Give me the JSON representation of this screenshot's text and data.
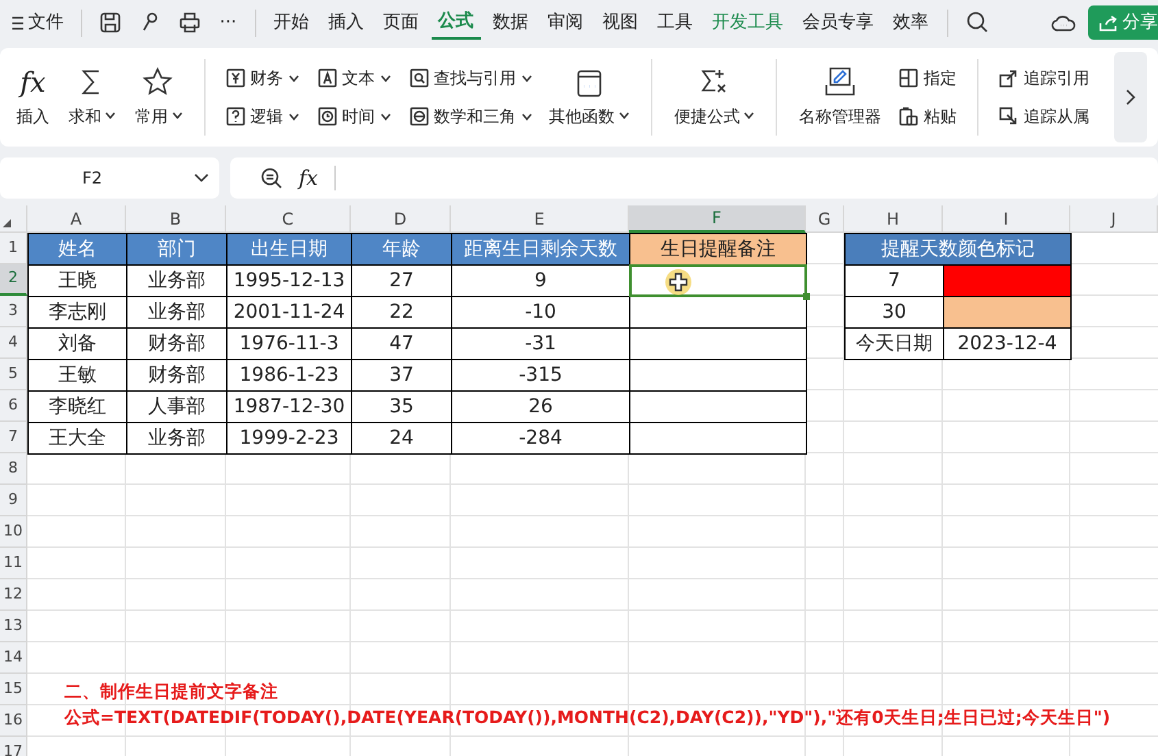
{
  "menu_bar": {
    "file_label": "文件",
    "more_label": "···",
    "tabs": [
      {
        "label": "开始",
        "selected": false,
        "accent": false
      },
      {
        "label": "插入",
        "selected": false,
        "accent": false
      },
      {
        "label": "页面",
        "selected": false,
        "accent": false
      },
      {
        "label": "公式",
        "selected": true,
        "accent": false
      },
      {
        "label": "数据",
        "selected": false,
        "accent": false
      },
      {
        "label": "审阅",
        "selected": false,
        "accent": false
      },
      {
        "label": "视图",
        "selected": false,
        "accent": false
      },
      {
        "label": "工具",
        "selected": false,
        "accent": false
      },
      {
        "label": "开发工具",
        "selected": false,
        "accent": true
      },
      {
        "label": "会员专享",
        "selected": false,
        "accent": false
      },
      {
        "label": "效率",
        "selected": false,
        "accent": false
      }
    ],
    "share_label": "分享"
  },
  "ribbon": {
    "groups": [
      {
        "items": [
          {
            "label": "插入",
            "glyph": "fx",
            "kind": "large",
            "dropdown": false
          },
          {
            "label": "求和",
            "kind": "large",
            "dropdown": true
          },
          {
            "label": "常用",
            "kind": "large",
            "dropdown": true
          }
        ]
      },
      {
        "items": [
          {
            "label": "财务",
            "kind": "small",
            "dropdown": true
          },
          {
            "label": "逻辑",
            "kind": "small",
            "dropdown": true
          },
          {
            "label": "文本",
            "kind": "small",
            "dropdown": true
          },
          {
            "label": "时间",
            "kind": "small",
            "dropdown": true
          },
          {
            "label": "查找与引用",
            "kind": "small",
            "dropdown": true
          },
          {
            "label": "数学和三角",
            "kind": "small",
            "dropdown": true
          },
          {
            "label": "其他函数",
            "kind": "large",
            "dropdown": true
          }
        ]
      },
      {
        "items": [
          {
            "label": "便捷公式",
            "kind": "large",
            "dropdown": true
          }
        ]
      },
      {
        "items": [
          {
            "label": "名称管理器",
            "kind": "large",
            "dropdown": false
          },
          {
            "label": "指定",
            "kind": "small",
            "dropdown": false
          },
          {
            "label": "粘贴",
            "kind": "small",
            "dropdown": false
          }
        ]
      },
      {
        "items": [
          {
            "label": "追踪引用",
            "kind": "small",
            "dropdown": false
          },
          {
            "label": "追踪从属",
            "kind": "small",
            "dropdown": false
          }
        ]
      }
    ]
  },
  "formula_bar": {
    "name_box": "F2",
    "fx_label": "fx"
  },
  "sheet": {
    "columns": [
      {
        "label": "A",
        "selected": false
      },
      {
        "label": "B",
        "selected": false
      },
      {
        "label": "C",
        "selected": false
      },
      {
        "label": "D",
        "selected": false
      },
      {
        "label": "E",
        "selected": false
      },
      {
        "label": "F",
        "selected": true
      },
      {
        "label": "G",
        "selected": false
      },
      {
        "label": "H",
        "selected": false
      },
      {
        "label": "I",
        "selected": false
      },
      {
        "label": "J",
        "selected": false
      }
    ],
    "row_headers": [
      {
        "label": "1",
        "selected": false
      },
      {
        "label": "2",
        "selected": true
      },
      {
        "label": "3",
        "selected": false
      },
      {
        "label": "4",
        "selected": false
      },
      {
        "label": "5",
        "selected": false
      },
      {
        "label": "6",
        "selected": false
      },
      {
        "label": "7",
        "selected": false
      },
      {
        "label": "8",
        "selected": false
      },
      {
        "label": "9",
        "selected": false
      },
      {
        "label": "10",
        "selected": false
      },
      {
        "label": "11",
        "selected": false
      },
      {
        "label": "12",
        "selected": false
      },
      {
        "label": "13",
        "selected": false
      },
      {
        "label": "14",
        "selected": false
      },
      {
        "label": "15",
        "selected": false
      },
      {
        "label": "16",
        "selected": false
      },
      {
        "label": "17",
        "selected": false
      }
    ],
    "main_table": {
      "header": [
        {
          "text": "姓名",
          "kind": "header"
        },
        {
          "text": "部门",
          "kind": "header"
        },
        {
          "text": "出生日期",
          "kind": "header"
        },
        {
          "text": "年龄",
          "kind": "header"
        },
        {
          "text": "距离生日剩余天数",
          "kind": "header"
        },
        {
          "text": "生日提醒备注",
          "kind": "highlight"
        }
      ],
      "rows": [
        [
          {
            "text": "王晓",
            "selected": false
          },
          {
            "text": "业务部",
            "selected": false
          },
          {
            "text": "1995-12-13",
            "selected": false
          },
          {
            "text": "27",
            "selected": false
          },
          {
            "text": "9",
            "selected": false
          },
          {
            "selected": true
          }
        ],
        [
          {
            "text": "李志刚",
            "selected": false
          },
          {
            "text": "业务部",
            "selected": false
          },
          {
            "text": "2001-11-24",
            "selected": false
          },
          {
            "text": "22",
            "selected": false
          },
          {
            "text": "-10",
            "selected": false
          },
          {
            "selected": false
          }
        ],
        [
          {
            "text": "刘备",
            "selected": false
          },
          {
            "text": "财务部",
            "selected": false
          },
          {
            "text": "1976-11-3",
            "selected": false
          },
          {
            "text": "47",
            "selected": false
          },
          {
            "text": "-31",
            "selected": false
          },
          {
            "selected": false
          }
        ],
        [
          {
            "text": "王敏",
            "selected": false
          },
          {
            "text": "财务部",
            "selected": false
          },
          {
            "text": "1986-1-23",
            "selected": false
          },
          {
            "text": "37",
            "selected": false
          },
          {
            "text": "-315",
            "selected": false
          },
          {
            "selected": false
          }
        ],
        [
          {
            "text": "李晓红",
            "selected": false
          },
          {
            "text": "人事部",
            "selected": false
          },
          {
            "text": "1987-12-30",
            "selected": false
          },
          {
            "text": "35",
            "selected": false
          },
          {
            "text": "26",
            "selected": false
          },
          {
            "selected": false
          }
        ],
        [
          {
            "text": "王大全",
            "selected": false
          },
          {
            "text": "业务部",
            "selected": false
          },
          {
            "text": "1999-2-23",
            "selected": false
          },
          {
            "text": "24",
            "selected": false
          },
          {
            "text": "-284",
            "selected": false
          },
          {
            "selected": false
          }
        ]
      ]
    },
    "side_table": {
      "title": "提醒天数颜色标记",
      "rows": [
        {
          "kind": "swatch",
          "label": "7",
          "color": "#ff0000"
        },
        {
          "kind": "swatch",
          "label": "30",
          "color": "#f8c08f"
        },
        {
          "kind": "value",
          "label": "今天日期",
          "value": "2023-12-4"
        }
      ]
    }
  },
  "note": {
    "title": "二、制作生日提前文字备注",
    "formula": "公式=TEXT(DATEDIF(TODAY(),DATE(YEAR(TODAY()),MONTH(C2),DAY(C2)),\"YD\"),\"还有0天生日;生日已过;今天生日\")"
  }
}
